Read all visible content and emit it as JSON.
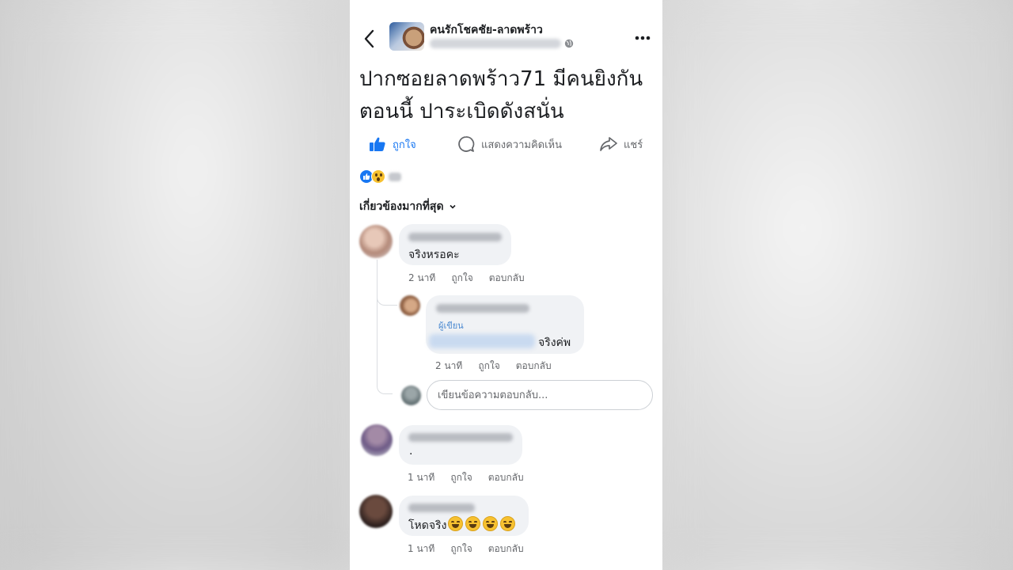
{
  "header": {
    "page_name": "คนรักโชคชัย-ลาดพร้าว",
    "back_icon": "chevron-left-icon",
    "globe_icon": "globe-icon",
    "more_icon": "more-dots-icon"
  },
  "post": {
    "text": "ปากซอยลาดพร้าว71 มีคนยิงกันตอนนี้ ปาระเบิดดังสนั่น"
  },
  "actions": {
    "like_label": "ถูกใจ",
    "comment_label": "แสดงความคิดเห็น",
    "share_label": "แชร์"
  },
  "reactions": [
    "like",
    "wow"
  ],
  "sort_label": "เกี่ยวข้องมากที่สุด",
  "comments": [
    {
      "text": "จริงหรอคะ",
      "time": "2 นาที",
      "like": "ถูกใจ",
      "reply": "ตอบกลับ",
      "replies": [
        {
          "author_tag": "ผู้เขียน",
          "text": "จริงค่พ",
          "time": "2 นาที",
          "like": "ถูกใจ",
          "reply": "ตอบกลับ"
        }
      ]
    },
    {
      "text": ".",
      "time": "1 นาที",
      "like": "ถูกใจ",
      "reply": "ตอบกลับ"
    },
    {
      "text": "โหดจริง",
      "emoji": "😂😂😂😂",
      "time": "1 นาที",
      "like": "ถูกใจ",
      "reply": "ตอบกลับ"
    }
  ],
  "reply_input": {
    "placeholder": "เขียนข้อความตอบกลับ..."
  },
  "colors": {
    "accent": "#1877f2",
    "bubble": "#f0f2f5",
    "meta": "#65676b"
  }
}
